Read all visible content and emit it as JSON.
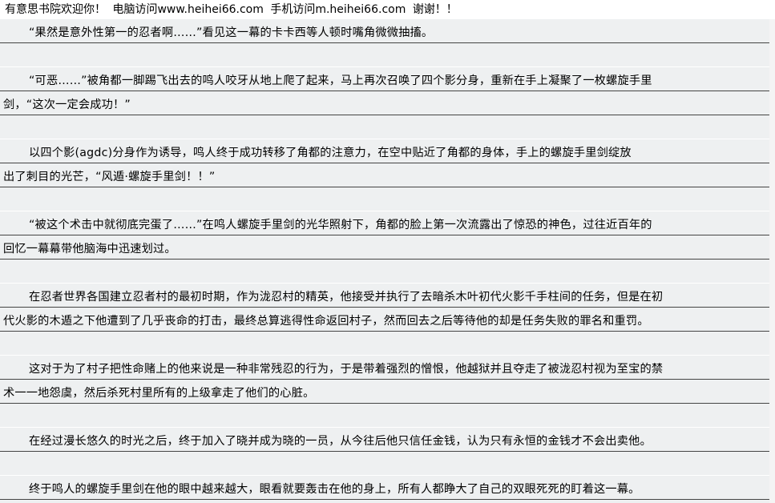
{
  "header": {
    "site_name": "有意思书院欢迎你！",
    "pc_visit": "电脑访问www.heihei66.com",
    "mobile_visit": "手机访问m.heihei66.com",
    "thanks": "谢谢！！"
  },
  "paragraphs": [
    {
      "lines": [
        "“果然是意外性第一的忍者啊……”看见这一幕的卡卡西等人顿时嘴角微微抽搐。"
      ]
    },
    {
      "lines": [
        "“可恶……”被角都一脚踢飞出去的鸣人咬牙从地上爬了起来，马上再次召唤了四个影分身，重新在手上凝聚了一枚螺旋手里",
        "剑，“这次一定会成功！”"
      ]
    },
    {
      "lines": [
        "以四个影(agdc)分身作为诱导，鸣人终于成功转移了角都的注意力，在空中贴近了角都的身体，手上的螺旋手里剑绽放",
        "出了刺目的光芒，“风遁·螺旋手里剑！！”"
      ]
    },
    {
      "lines": [
        "“被这个术击中就彻底完蛋了……”在鸣人螺旋手里剑的光华照射下，角都的脸上第一次流露出了惊恐的神色，过往近百年的",
        "回忆一幕幕带他脑海中迅速划过。"
      ]
    },
    {
      "lines": [
        "在忍者世界各国建立忍者村的最初时期，作为泷忍村的精英，他接受并执行了去暗杀木叶初代火影千手柱间的任务，但是在初",
        "代火影的木遁之下他遭到了几乎丧命的打击，最终总算逃得性命返回村子，然而回去之后等待他的却是任务失败的罪名和重罚。"
      ]
    },
    {
      "lines": [
        "这对于为了村子把性命赌上的他来说是一种非常残忍的行为，于是带着强烈的憎恨，他越狱并且夺走了被泷忍村视为至宝的禁",
        "术一一地怨虞，然后杀死村里所有的上级拿走了他们的心脏。"
      ]
    },
    {
      "lines": [
        "在经过漫长悠久的时光之后，终于加入了晓并成为晓的一员，从今往后他只信任金钱，认为只有永恒的金钱才不会出卖他。"
      ]
    },
    {
      "lines": [
        "终于鸣人的螺旋手里剑在他的眼中越来越大，眼看就要轰击在他的身上，所有人都睁大了自己的双眼死死的盯着这一幕。"
      ]
    }
  ]
}
